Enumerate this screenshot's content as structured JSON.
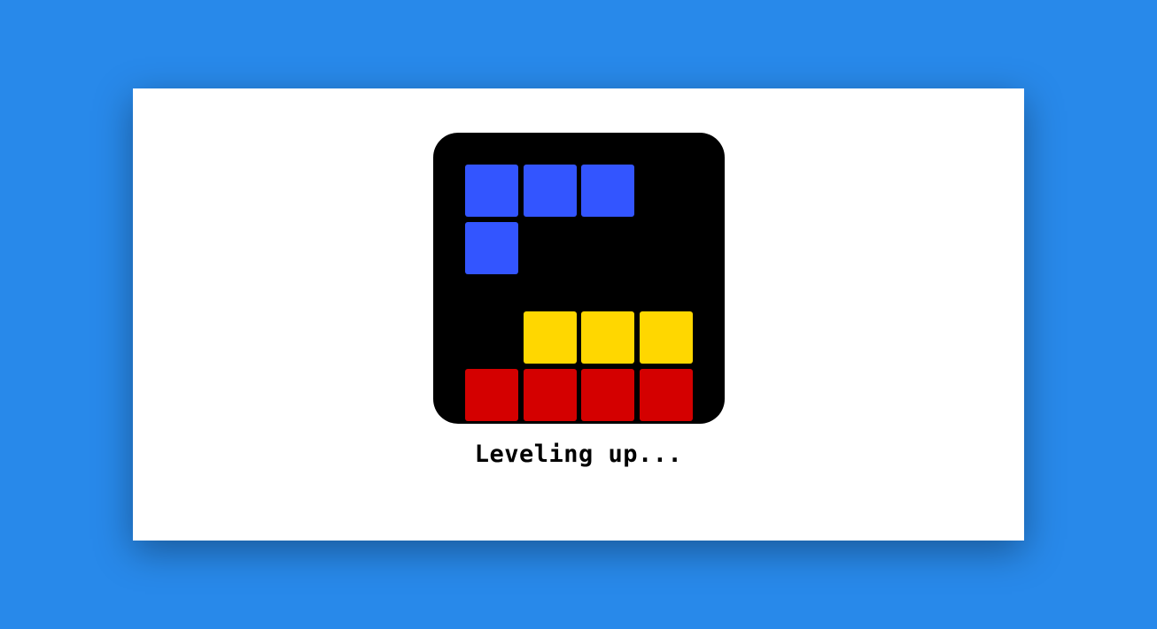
{
  "status": {
    "text": "Leveling up..."
  },
  "colors": {
    "background": "#2889EA",
    "card": "#FFFFFF",
    "board": "#000000",
    "blue": "#3355FF",
    "yellow": "#FFD700",
    "red": "#D40000"
  },
  "blocks": [
    {
      "col": 0,
      "row": 0,
      "color": "blue"
    },
    {
      "col": 1,
      "row": 0,
      "color": "blue"
    },
    {
      "col": 2,
      "row": 0,
      "color": "blue"
    },
    {
      "col": 0,
      "row": 1,
      "color": "blue"
    },
    {
      "col": 1,
      "row": 2.55,
      "color": "yellow"
    },
    {
      "col": 2,
      "row": 2.55,
      "color": "yellow"
    },
    {
      "col": 3,
      "row": 2.55,
      "color": "yellow"
    },
    {
      "col": 0,
      "row": 3.55,
      "color": "red"
    },
    {
      "col": 1,
      "row": 3.55,
      "color": "red"
    },
    {
      "col": 2,
      "row": 3.55,
      "color": "red"
    },
    {
      "col": 3,
      "row": 3.55,
      "color": "red"
    }
  ]
}
